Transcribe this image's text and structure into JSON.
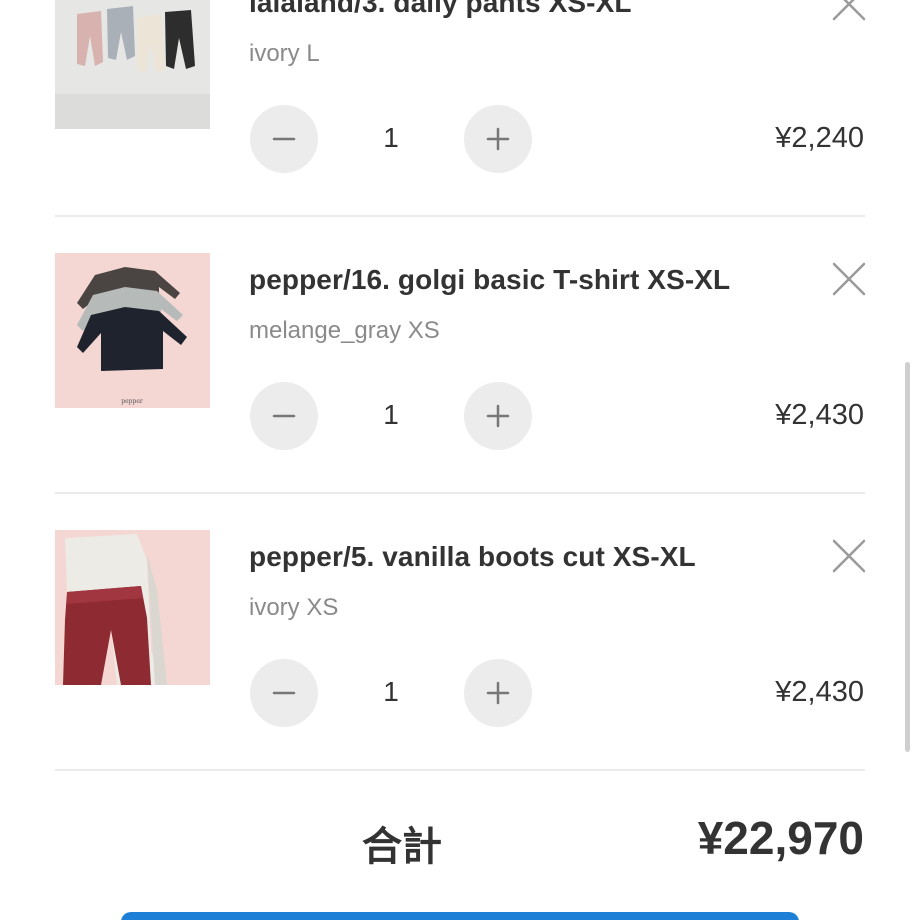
{
  "cart": {
    "items": [
      {
        "name": "lalaland/3. daily pants XS-XL",
        "variant": "ivory L",
        "quantity": "1",
        "price": "¥2,240",
        "thumbnail_icon": "pants-photo"
      },
      {
        "name": "pepper/16. golgi basic T-shirt XS-XL",
        "variant": "melange_gray XS",
        "quantity": "1",
        "price": "¥2,430",
        "thumbnail_icon": "tshirt-photo",
        "thumbnail_caption": "pepper"
      },
      {
        "name": "pepper/5. vanilla boots cut XS-XL",
        "variant": "ivory XS",
        "quantity": "1",
        "price": "¥2,430",
        "thumbnail_icon": "leggings-photo"
      }
    ],
    "total_label": "合計",
    "total_value": "¥22,970"
  },
  "icons": {
    "remove": "close-icon",
    "decrement": "minus-icon",
    "increment": "plus-icon"
  },
  "colors": {
    "text": "#333333",
    "muted": "#8a8a8a",
    "button_bg": "#ececec",
    "divider": "#ebebeb",
    "accent": "#1e7fd6"
  }
}
